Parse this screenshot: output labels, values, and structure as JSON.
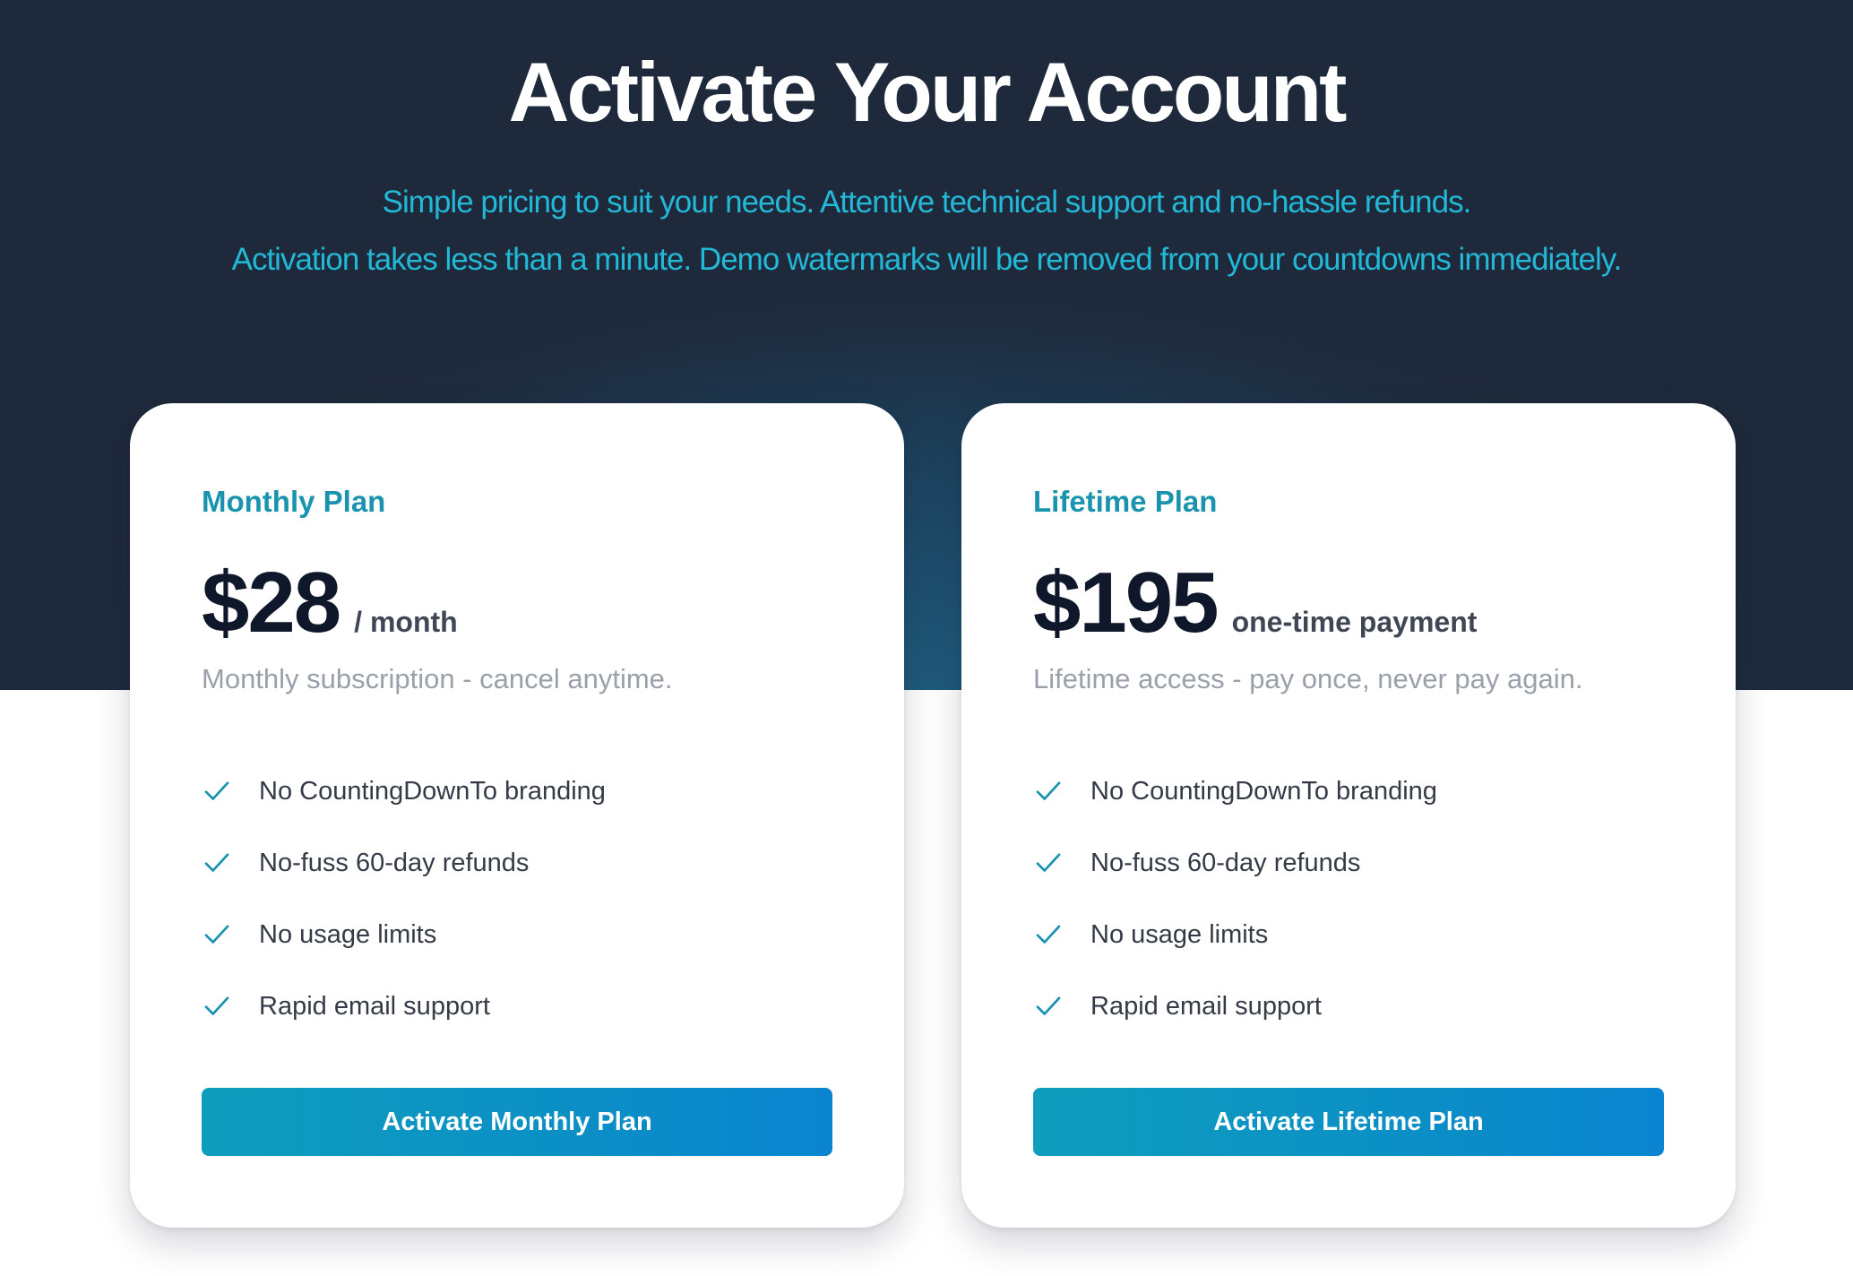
{
  "header": {
    "title": "Activate Your Account",
    "subtitle_line1": "Simple pricing to suit your needs. Attentive technical support and no-hassle refunds.",
    "subtitle_line2": "Activation takes less than a minute. Demo watermarks will be removed from your countdowns immediately."
  },
  "colors": {
    "hero_background": "#1e293b",
    "accent": "#1a94ae",
    "subtitle": "#22b8d6",
    "button": "#0b8fc6"
  },
  "plans": [
    {
      "name": "Monthly Plan",
      "price": "$28",
      "period": "/ month",
      "description": "Monthly subscription - cancel anytime.",
      "features": [
        "No CountingDownTo branding",
        "No-fuss 60-day refunds",
        "No usage limits",
        "Rapid email support"
      ],
      "button_label": "Activate Monthly Plan"
    },
    {
      "name": "Lifetime Plan",
      "price": "$195",
      "period": "one-time payment",
      "description": "Lifetime access - pay once, never pay again.",
      "features": [
        "No CountingDownTo branding",
        "No-fuss 60-day refunds",
        "No usage limits",
        "Rapid email support"
      ],
      "button_label": "Activate Lifetime Plan"
    }
  ],
  "icons": {
    "feature_check": "check-icon"
  }
}
